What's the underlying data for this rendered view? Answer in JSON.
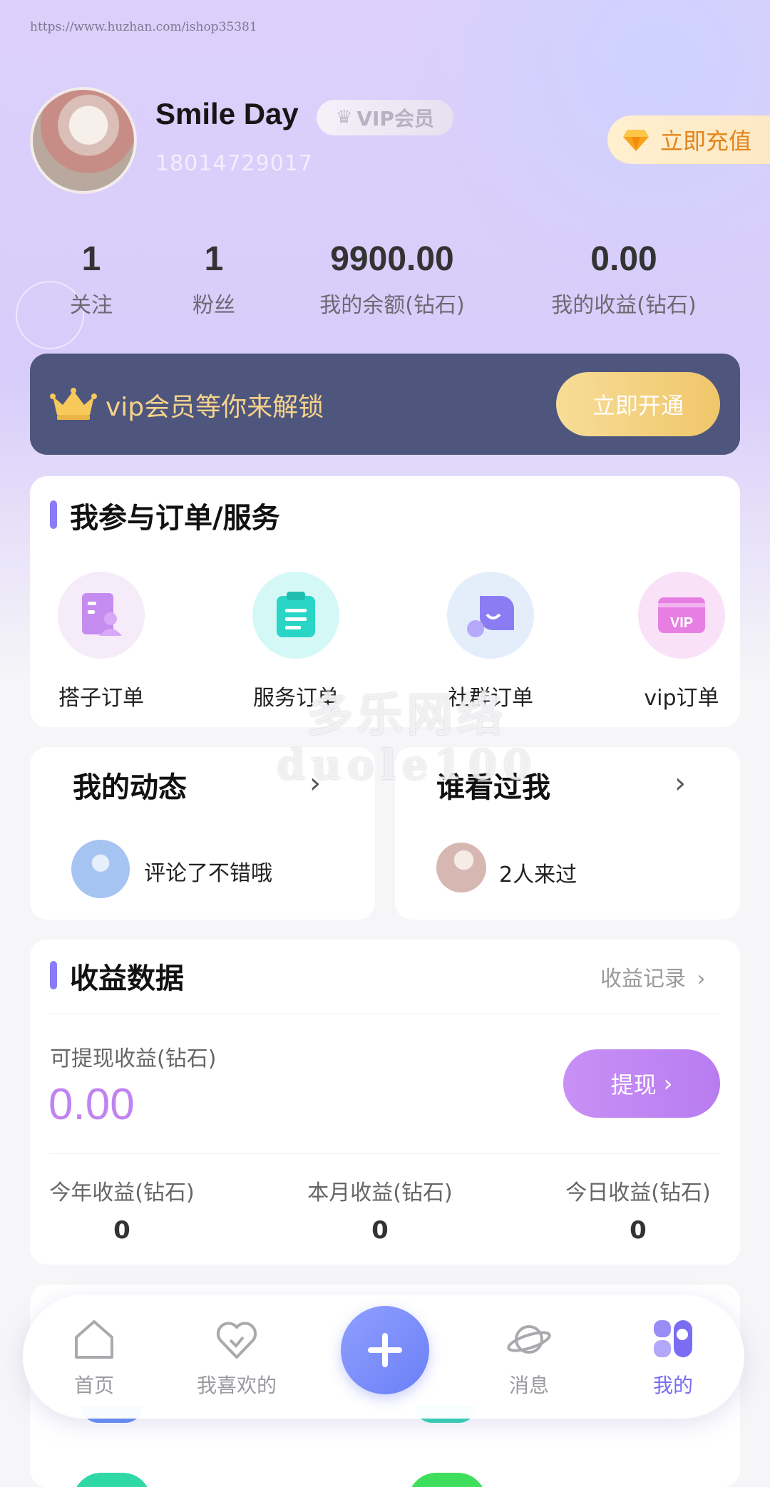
{
  "url_text": "https://www.huzhan.com/ishop35381",
  "profile": {
    "name": "Smile Day",
    "vip_badge": "VIP会员",
    "phone": "18014729017",
    "recharge_label": "立即充值"
  },
  "stats": [
    {
      "value": "1",
      "label": "关注"
    },
    {
      "value": "1",
      "label": "粉丝"
    },
    {
      "value": "9900.00",
      "label": "我的余额(钻石)"
    },
    {
      "value": "0.00",
      "label": "我的收益(钻石)"
    }
  ],
  "vip_banner": {
    "text": "vip会员等你来解锁",
    "button": "立即开通"
  },
  "orders": {
    "title": "我参与订单/服务",
    "items": [
      {
        "label": "搭子订单",
        "icon": "partner-order-icon"
      },
      {
        "label": "服务订单",
        "icon": "clipboard-icon"
      },
      {
        "label": "社群订单",
        "icon": "chat-bubble-icon"
      },
      {
        "label": "vip订单",
        "icon": "vip-card-icon"
      }
    ]
  },
  "moments": {
    "title": "我的动态",
    "desc": "评论了不错哦"
  },
  "visitors": {
    "title": "谁看过我",
    "desc": "2人来过"
  },
  "earnings": {
    "title": "收益数据",
    "record_link": "收益记录",
    "withdrawable_label": "可提现收益(钻石)",
    "withdrawable_value": "0.00",
    "withdraw_button": "提现",
    "breakdown": [
      {
        "label": "今年收益(钻石)",
        "value": "0"
      },
      {
        "label": "本月收益(钻石)",
        "value": "0"
      },
      {
        "label": "今日收益(钻石)",
        "value": "0"
      }
    ]
  },
  "watermark": {
    "line1": "多乐网络",
    "line2": "duole100"
  },
  "tabbar": {
    "items": [
      {
        "label": "首页",
        "icon": "home-icon"
      },
      {
        "label": "我喜欢的",
        "icon": "heart-check-icon"
      },
      {
        "label": "消息",
        "icon": "planet-icon"
      },
      {
        "label": "我的",
        "icon": "profile-blocks-icon"
      }
    ]
  },
  "colors": {
    "accent": "#7b6cf4",
    "vip_gold": "#f6d38b",
    "banner_bg": "#4e567e",
    "earn_purple": "#c183ef",
    "recharge_orange": "#e3841a"
  }
}
